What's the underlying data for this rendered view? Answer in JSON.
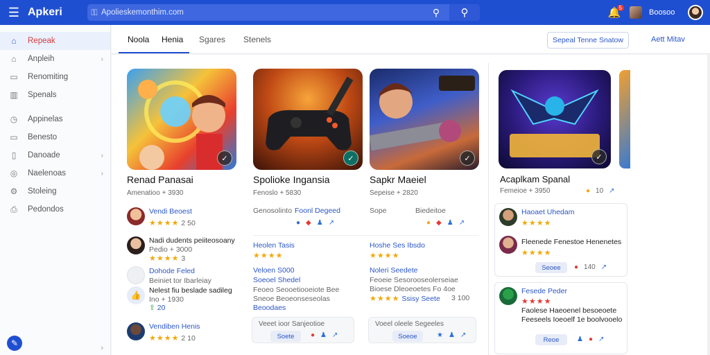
{
  "app": {
    "brand": "Apkeri",
    "menu_icon": "menu-icon"
  },
  "search": {
    "value": "Apolieskemonthim.com",
    "placeholder": "Apolieskemonthim.com"
  },
  "header_right": {
    "notif_count": "5",
    "user_name": "Boosoo"
  },
  "sidebar": {
    "items": [
      {
        "label": "Repeak",
        "icon": "home-icon",
        "active": true
      },
      {
        "label": "Anpleih",
        "icon": "apps-icon",
        "chevron": true
      },
      {
        "label": "Renomiting",
        "icon": "document-icon"
      },
      {
        "label": "Spenals",
        "icon": "chart-icon"
      },
      {
        "label": "Appinelas",
        "icon": "clock-icon"
      },
      {
        "label": "Benesto",
        "icon": "folder-icon"
      },
      {
        "label": "Danoade",
        "icon": "file-icon",
        "chevron": true
      },
      {
        "label": "Naelenoas",
        "icon": "globe-icon",
        "chevron": true
      },
      {
        "label": "Stoleing",
        "icon": "settings-icon"
      },
      {
        "label": "Pedondos",
        "icon": "print-icon"
      }
    ]
  },
  "tabs": [
    {
      "label": "Noola",
      "active": true
    },
    {
      "label": "Henia"
    },
    {
      "label": "Sgares"
    },
    {
      "label": "Stenels"
    }
  ],
  "toolbar": {
    "primary_label": "Sepeal Tenne Snatow",
    "link_label": "Aett Mitav"
  },
  "cards": [
    {
      "title": "Renad Panasai",
      "sub": "Amenatioo + 3930",
      "reviews": [
        {
          "name": "Vendi Beoest",
          "rating": "2 50"
        },
        {
          "name": "Nadi dudents peiiteosoany",
          "sub": "Pedio + 3000",
          "rating": "3"
        },
        {
          "name": "Dohode Feled",
          "sub": "Beiniet tor Ibarleiay"
        },
        {
          "name": "Nelest fiu beslade sadileg",
          "sub": "Ino + 1930",
          "rating": "20"
        },
        {
          "name": "Vendiben Henis",
          "rating": "2 10"
        }
      ]
    },
    {
      "title": "Spolioke Ingansia",
      "sub": "Fenoslo + 5830",
      "meta_left": "Genosolinto",
      "meta_right": "Foonl Degeed",
      "block1_title": "Heolen Tasis",
      "block2_title": "Veloen S000",
      "block2_sub": "Soeoel Shedel",
      "block2_line": "Feoeo Seooetiooeiote Bee",
      "block2_line2": "Sneoe Beoeonseseolas",
      "block2_line3": "Beoodaes",
      "panel_text": "Veeet ioor Sanjeotioe",
      "pill": "Soete"
    },
    {
      "title": "Sapkr Maeiel",
      "sub": "Sepeise + 2820",
      "meta_left": "Sope",
      "meta_right": "Biedeitoe",
      "block1_title": "Hoshe Ses Ibsdo",
      "block2_title": "Noleri Seedete",
      "block2_line": "Feoeie Sesorooseolerseiae",
      "block2_line2": "Bioese Dleoeoetes Fo 4oe",
      "block2_line3": "Ssisy Seete",
      "block2_num": "3 100",
      "panel_text": "Voeel oleele Segeeles",
      "pill": "Soeoe"
    }
  ],
  "right": {
    "title": "Acaplkam Spanal",
    "sub": "Femeioe + 3950",
    "reviews": [
      {
        "name": "Haoaet Uhedam",
        "stars": "5"
      },
      {
        "name": "Fleenede Fenestoe Henenetes"
      },
      {
        "name": "Fesede Peder",
        "sub": "Faolese Haeoenel besoeoete",
        "sub2": "Feeseels Ioeoelf 1e boolvooelo"
      }
    ],
    "pill1": "Seoee",
    "pill2": "Reoe",
    "num1": "140",
    "num2": "10"
  },
  "theme": {
    "accent": "#1f4fd1",
    "star": "#f2a80c"
  }
}
